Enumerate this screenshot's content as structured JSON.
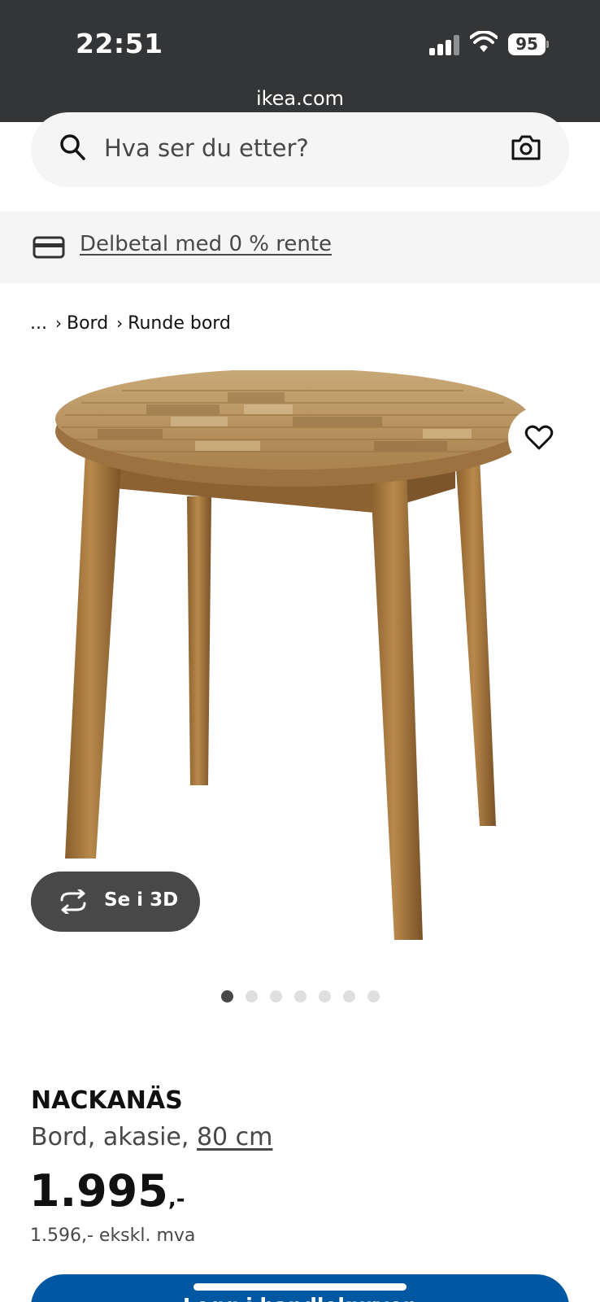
{
  "status_bar": {
    "time": "22:51",
    "battery": "95",
    "url": "ikea.com",
    "icons": [
      "signal-icon",
      "wifi-icon",
      "battery-icon"
    ]
  },
  "search": {
    "placeholder": "Hva ser du etter?",
    "icons": [
      "search-icon",
      "camera-icon"
    ]
  },
  "promo": {
    "label": "Delbetal med 0 % rente",
    "icon": "card-icon"
  },
  "breadcrumb": {
    "ellipsis": "...",
    "items": [
      "Bord",
      "Runde bord"
    ],
    "separator": "›"
  },
  "gallery": {
    "view_3d_label": "Se i 3D",
    "dots_total": 7,
    "active_dot": 1,
    "favourite_icon": "heart-icon"
  },
  "product": {
    "name": "NACKANÄS",
    "description": "Bord, akasie, ",
    "size": "80 cm",
    "price": "1.995",
    "price_suffix": ",-",
    "price_ex_vat": "1.596,- ekskl. mva"
  },
  "cart": {
    "label": "Legg i handlekurven"
  },
  "colors": {
    "status_bar": "#333537",
    "cta_blue": "#0058a3",
    "panel_grey": "#f5f5f5",
    "text_dark": "#111111",
    "text_grey": "#484848"
  }
}
